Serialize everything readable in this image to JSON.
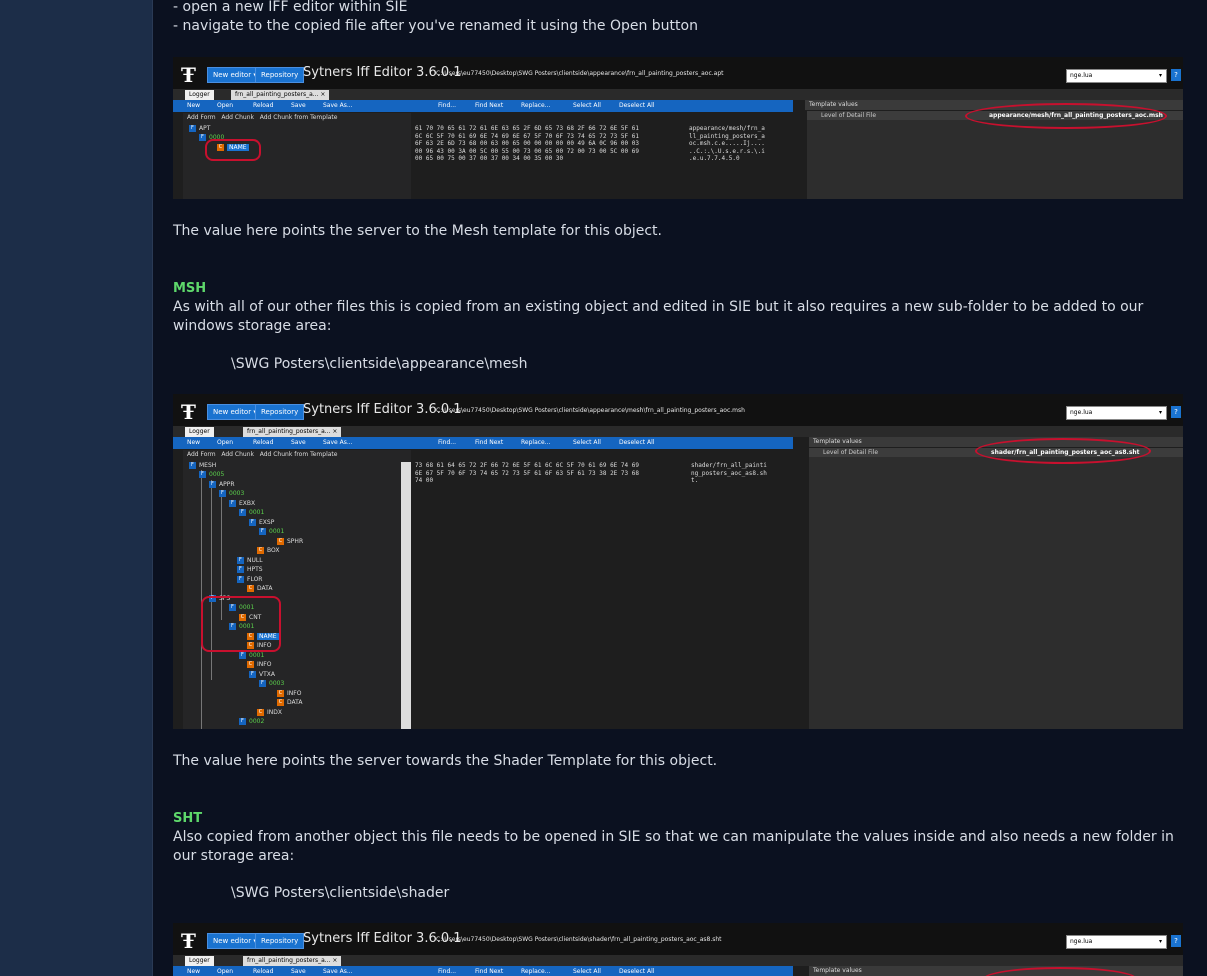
{
  "intro_lines": {
    "line1": "- open a new IFF editor within SIE",
    "line2": "- navigate to the copied file after you've renamed it using the Open button"
  },
  "paragraph_mesh_template": "The value here points the server to the Mesh template for this object.",
  "msh_section": {
    "heading": "MSH",
    "body": "As with all of our other files this is copied from an existing object and edited in SIE but it also requires a new sub-folder to be added to our windows storage area:",
    "path": "\\SWG Posters\\clientside\\appearance\\mesh"
  },
  "paragraph_shader_template": "The value here points the server towards the Shader Template for this object.",
  "sht_section": {
    "heading": "SHT",
    "body": "Also copied from another object this file needs to be opened in SIE so that we can manipulate the values inside and also needs a new folder in our storage area:",
    "path": "\\SWG Posters\\clientside\\shader"
  },
  "sie": {
    "title": "Sytners Iff Editor 3.6.0.1",
    "new_editor": "New editor ▾",
    "repository": "Repository",
    "lua": "nge.lua",
    "logger_tab": "Logger",
    "template_values": "Template values",
    "level_of_detail": "Level of Detail File",
    "toolbar": {
      "new": "New",
      "open": "Open",
      "reload": "Reload",
      "save": "Save",
      "save_as": "Save As...",
      "find": "Find...",
      "find_next": "Find Next",
      "replace": "Replace...",
      "select_all": "Select All",
      "deselect_all": "Deselect All",
      "add_form": "Add Form",
      "add_chunk": "Add Chunk",
      "add_chunk_template": "Add Chunk from Template"
    }
  },
  "shot1": {
    "path": "C:\\Users\\eu77450\\Desktop\\SWG Posters\\clientside\\appearance\\frn_all_painting_posters_aoc.apt",
    "tree": {
      "root": "APT",
      "form": "0000",
      "chunk": "NAME"
    },
    "hex": "61 70 70 65 61 72 61 6E 63 65 2F 6D 65 73 68 2F 66 72 6E 5F 61\n6C 6C 5F 70 61 69 6E 74 69 6E 67 5F 70 6F 73 74 65 72 73 5F 61\n6F 63 2E 6D 73 68 00 63 00 65 00 00 00 00 00 49 6A 0C 96 00 03\n00 96 43 00 3A 00 5C 00 55 00 73 00 65 00 72 00 73 00 5C 00 69\n00 65 00 75 00 37 00 37 00 34 00 35 00 30",
    "ascii": "appearance/mesh/frn_a\nll_painting_posters_a\noc.msh.c.e.....Ij....\n..C.:.\\.U.s.e.r.s.\\.i\n.e.u.7.7.4.5.0",
    "value": "appearance/mesh/frn_all_painting_posters_aoc.msh"
  },
  "shot2": {
    "path": "C:\\Users\\eu77450\\Desktop\\SWG Posters\\clientside\\appearance\\mesh\\frn_all_painting_posters_aoc.msh",
    "tab": "frn_all_painting_posters_a... ×",
    "hex": "73 68 61 64 65 72 2F 66 72 6E 5F 61 6C 6C 5F 70 61 69 6E 74 69\n6E 67 5F 70 6F 73 74 65 72 73 5F 61 6F 63 5F 61 73 38 2E 73 68\n74 00",
    "ascii": "shader/frn_all_painti\nng_posters_aoc_as8.sh\nt.",
    "value": "shader/frn_all_painting_posters_aoc_as8.sht",
    "tree": {
      "mesh": "MESH",
      "n0005": "0005",
      "appr": "APPR",
      "n0003": "0003",
      "exbx": "EXBX",
      "n0001a": "0001",
      "exsp": "EXSP",
      "n0001b": "0001",
      "sphr": "SPHR",
      "box": "BOX",
      "null": "NULL",
      "hpts": "HPTS",
      "flor": "FLOR",
      "data": "DATA",
      "sps": "SPS",
      "n0001c": "0001",
      "cnt": "CNT",
      "n0001d": "0001",
      "name": "NAME",
      "info": "INFO",
      "n0001e": "0001",
      "info2": "INFO",
      "vtxa": "VTXA",
      "n0003b": "0003",
      "info3": "INFO",
      "data2": "DATA",
      "indx": "INDX",
      "n0002": "0002"
    }
  },
  "shot3": {
    "path": "C:\\Users\\eu77450\\Desktop\\SWG Posters\\clientside\\shader\\frn_all_painting_posters_aoc_as8.sht",
    "tab": "frn_all_painting_posters_a... ×"
  }
}
